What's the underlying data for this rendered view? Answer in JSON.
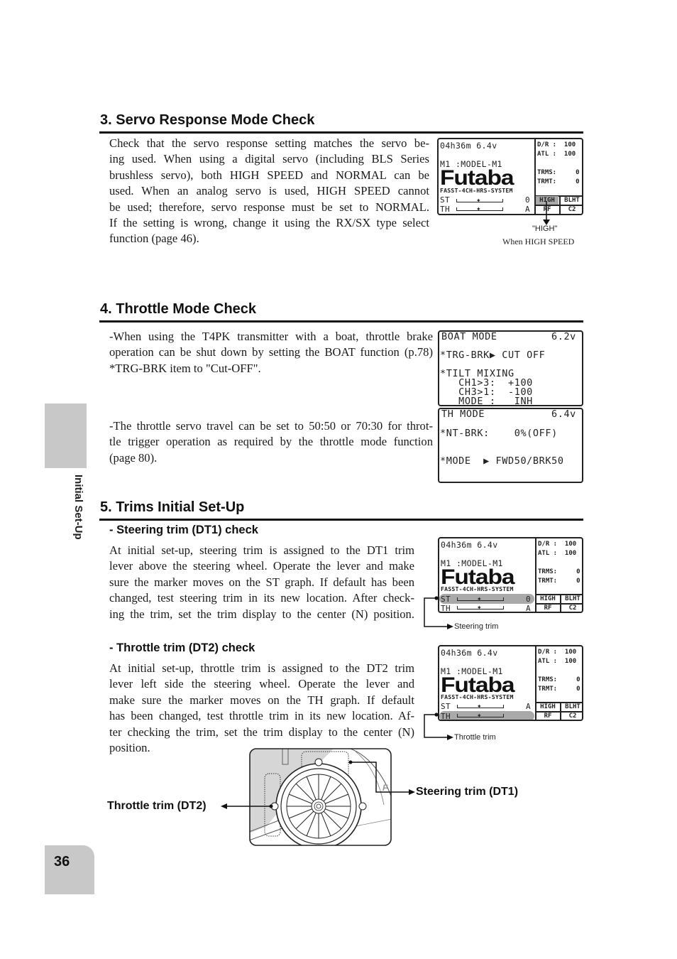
{
  "side_tab": {
    "label": "Initial Set-Up"
  },
  "page_number": "36",
  "sections": {
    "servo": {
      "title": "3. Servo Response Mode Check",
      "lines": [
        "Check that the servo response setting matches the servo be-",
        "ing used. When using a digital servo (including BLS Series",
        "brushless servo), both HIGH SPEED and NORMAL can be",
        "used. When an analog servo is used, HIGH SPEED cannot",
        "be used; therefore, servo response must be set to NORMAL.",
        "If the setting is wrong, change it using the RX/SX type select",
        "function (page 46)."
      ],
      "callout_label": "\"HIGH\"",
      "callout_caption": "When HIGH SPEED"
    },
    "throttle": {
      "title": "4. Throttle Mode Check",
      "para1": [
        "-When using the T4PK transmitter with a boat, throttle brake",
        "operation can be shut down by setting the BOAT function (p.78)",
        "*TRG-BRK item to \"Cut-OFF\"."
      ],
      "para2": [
        "-The throttle servo travel can be set to 50:50 or 70:30 for throt-",
        "tle trigger operation as required by the throttle mode function",
        "(page 80)."
      ]
    },
    "trims": {
      "title": "5. Trims Initial Set-Up",
      "steering": {
        "subtitle": "- Steering trim (DT1) check",
        "lines": [
          "At initial set-up, steering trim is assigned to the DT1 trim",
          "lever above the steering wheel. Operate the lever and make",
          "sure the marker moves on the ST graph. If default has been",
          "changed, test steering trim in its new location. After check-",
          "ing the trim, set the trim display to the center (N) position."
        ],
        "callout": "Steering trim"
      },
      "throttle": {
        "subtitle": "- Throttle trim (DT2) check",
        "lines": [
          "At initial set-up, throttle trim is assigned to the DT2 trim",
          "lever left side the steering wheel. Operate the lever and",
          "make sure the marker moves on the TH graph. If default",
          "has been changed, test throttle trim in its new location. Af-",
          "ter checking the trim, set the trim display to the center (N)",
          "position."
        ],
        "callout": "Throttle trim"
      },
      "illustration": {
        "left_label": "Throttle trim (DT2)",
        "right_label": "Steering trim (DT1)"
      }
    }
  },
  "home_screen": {
    "timer_voltage": "04h36m 6.4v",
    "model": "M1 :MODEL-M1",
    "brand": "Futaba",
    "system": "FASST-4CH-HRS-SYSTEM",
    "dr": "D/R :  100",
    "atl": "ATL :  100",
    "trms": "TRMS:     0",
    "trmt": "TRMT:     0",
    "st_label": "ST",
    "th_label": "TH",
    "st_value": "0",
    "th_value": "A",
    "cells": [
      "HIGH",
      "BLHT",
      "RF",
      "C2"
    ],
    "cells_first_screen": [
      "HIGH",
      "BLHT",
      "RF",
      "C2"
    ]
  },
  "boat_screen": {
    "header": "BOAT MODE",
    "voltage": "6.2v",
    "trg_brk": "*TRG-BRK▶ CUT OFF",
    "tilt": "*TILT MIXING",
    "ch13": "   CH1>3:  +100",
    "ch31": "   CH3>1:  -100",
    "mode": "   MODE :   INH"
  },
  "th_mode_screen": {
    "header": "TH MODE",
    "voltage": "6.4v",
    "nt_brk": "*NT-BRK:    0%(OFF)",
    "mode": "*MODE  ▶ FWD50/BRK50"
  },
  "colors": {
    "tab_gray": "#c8c8c8",
    "highlight_gray": "#a9a9a9",
    "text": "#1a1a1a"
  }
}
